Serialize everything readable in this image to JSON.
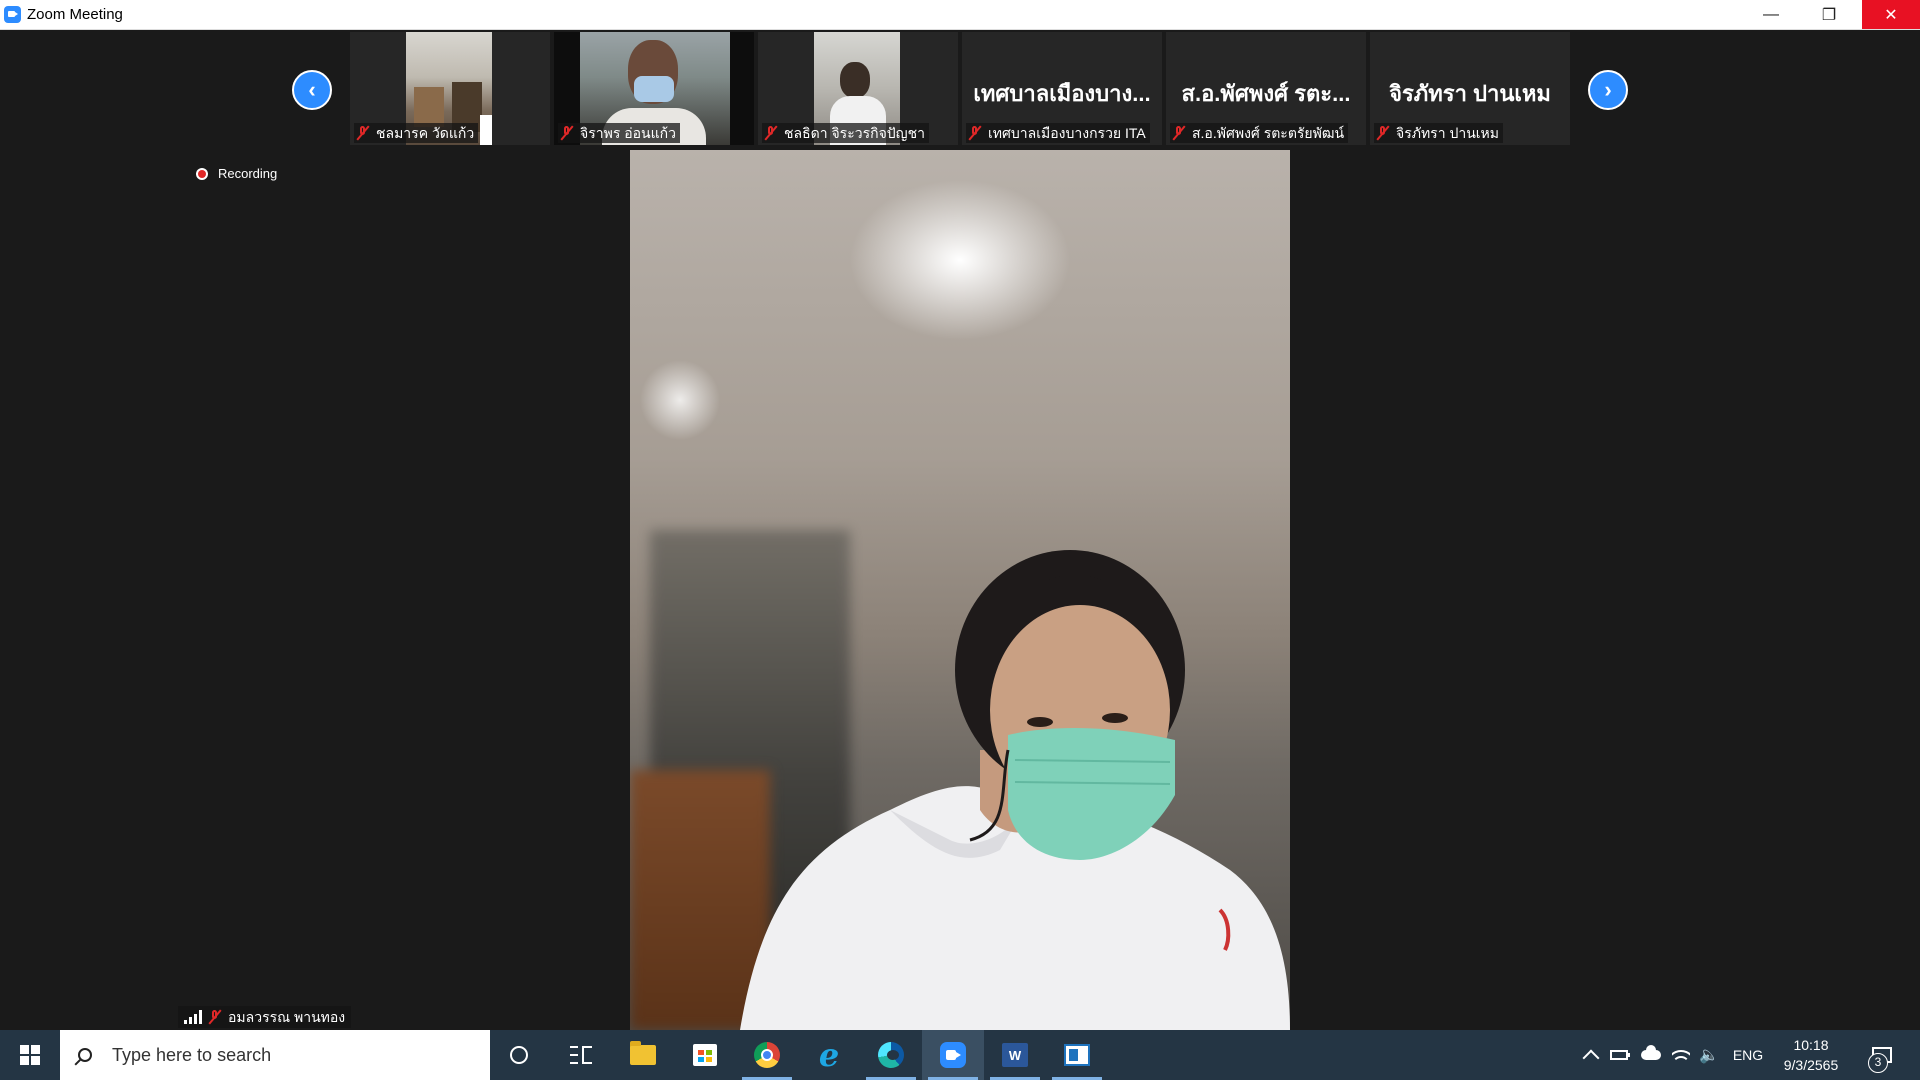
{
  "window": {
    "title": "Zoom Meeting",
    "controls": {
      "minimize": "—",
      "restore": "❐",
      "close": "✕"
    }
  },
  "thumbnails": {
    "prev_icon": "chevron-left-icon",
    "next_icon": "chevron-right-icon",
    "tiles": [
      {
        "caption": "ชลมารค วัดแก้ว",
        "has_video": true,
        "muted": true
      },
      {
        "caption": "จิราพร อ่อนแก้ว",
        "has_video": true,
        "muted": true
      },
      {
        "caption": "ชลธิดา จิระวรกิจปัญชา",
        "has_video": true,
        "muted": true
      },
      {
        "caption": "เทศบาลเมืองบางกรวย ITA",
        "display_name": "เทศบาลเมืองบาง...",
        "has_video": false,
        "muted": true
      },
      {
        "caption": "ส.อ.พัศพงศ์ รตะตรัยพัฒน์",
        "display_name": "ส.อ.พัศพงศ์ รตะ...",
        "has_video": false,
        "muted": true
      },
      {
        "caption": "จิรภัทรา ปานเหม",
        "display_name": "จิรภัทรา ปานเหม",
        "has_video": false,
        "muted": true
      }
    ]
  },
  "recording": {
    "label": "Recording",
    "color": "#e02828"
  },
  "active_speaker": {
    "name": "อมลวรรณ พานทอง",
    "muted": true
  },
  "taskbar": {
    "search_placeholder": "Type here to search",
    "apps": [
      "task-view",
      "file-explorer",
      "microsoft-store",
      "chrome",
      "internet-explorer",
      "edge",
      "zoom",
      "word",
      "blue-app"
    ],
    "word_label": "W",
    "language": "ENG",
    "time": "10:18",
    "date": "9/3/2565",
    "notification_count": "3"
  },
  "colors": {
    "accent": "#2d8cff",
    "taskbar": "#243544",
    "muted": "#e02828"
  }
}
